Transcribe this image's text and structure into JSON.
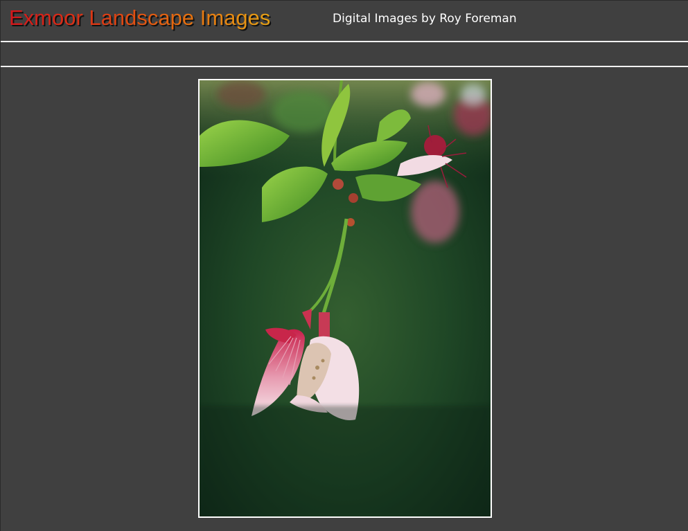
{
  "header": {
    "title": "Exmoor Landscape Images",
    "subtitle": "Digital Images by Roy Foreman"
  },
  "photo": {
    "subject": "blossom-photo"
  },
  "colors": {
    "background": "#404040",
    "rule": "#f2f2f2",
    "title_gradient_start": "#d4161b",
    "title_gradient_end": "#e6a114",
    "subtitle": "#ffffff"
  }
}
